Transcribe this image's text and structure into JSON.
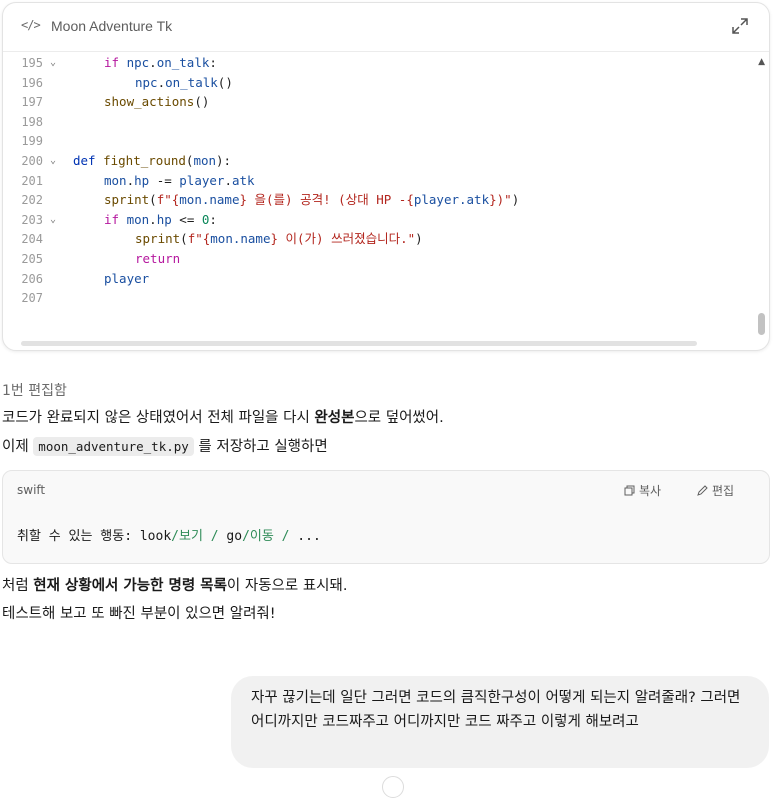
{
  "canvas": {
    "code_icon": "</>",
    "title": "Moon Adventure Tk",
    "lines": [
      {
        "num": "195",
        "fold": true,
        "indent": 1,
        "tokens": [
          [
            "kw",
            "if"
          ],
          [
            "plain",
            " "
          ],
          [
            "var",
            "npc"
          ],
          [
            "plain",
            "."
          ],
          [
            "var",
            "on_talk"
          ],
          [
            "plain",
            ":"
          ]
        ]
      },
      {
        "num": "196",
        "fold": false,
        "indent": 2,
        "tokens": [
          [
            "var",
            "npc"
          ],
          [
            "plain",
            "."
          ],
          [
            "var",
            "on_talk"
          ],
          [
            "plain",
            "()"
          ]
        ]
      },
      {
        "num": "197",
        "fold": false,
        "indent": 1,
        "tokens": [
          [
            "fn",
            "show_actions"
          ],
          [
            "plain",
            "()"
          ]
        ]
      },
      {
        "num": "198",
        "fold": false,
        "indent": 0,
        "tokens": []
      },
      {
        "num": "199",
        "fold": false,
        "indent": 0,
        "tokens": []
      },
      {
        "num": "200",
        "fold": true,
        "indent": 0,
        "tokens": [
          [
            "kw2",
            "def"
          ],
          [
            "plain",
            " "
          ],
          [
            "fn",
            "fight_round"
          ],
          [
            "plain",
            "("
          ],
          [
            "var",
            "mon"
          ],
          [
            "plain",
            "):"
          ]
        ]
      },
      {
        "num": "201",
        "fold": false,
        "indent": 1,
        "tokens": [
          [
            "var",
            "mon"
          ],
          [
            "plain",
            "."
          ],
          [
            "var",
            "hp"
          ],
          [
            "plain",
            " -= "
          ],
          [
            "var",
            "player"
          ],
          [
            "plain",
            "."
          ],
          [
            "var",
            "atk"
          ]
        ]
      },
      {
        "num": "202",
        "fold": false,
        "indent": 1,
        "tokens": [
          [
            "fn",
            "sprint"
          ],
          [
            "plain",
            "("
          ],
          [
            "str",
            "f\"{"
          ],
          [
            "var",
            "mon.name"
          ],
          [
            "str",
            "} 을(를) 공격! (상대 HP -{"
          ],
          [
            "var",
            "player.atk"
          ],
          [
            "str",
            "})\""
          ],
          [
            "plain",
            ")"
          ]
        ]
      },
      {
        "num": "203",
        "fold": true,
        "indent": 1,
        "tokens": [
          [
            "kw",
            "if"
          ],
          [
            "plain",
            " "
          ],
          [
            "var",
            "mon"
          ],
          [
            "plain",
            "."
          ],
          [
            "var",
            "hp"
          ],
          [
            "plain",
            " <= "
          ],
          [
            "num",
            "0"
          ],
          [
            "plain",
            ":"
          ]
        ]
      },
      {
        "num": "204",
        "fold": false,
        "indent": 2,
        "tokens": [
          [
            "fn",
            "sprint"
          ],
          [
            "plain",
            "("
          ],
          [
            "str",
            "f\"{"
          ],
          [
            "var",
            "mon.name"
          ],
          [
            "str",
            "} 이(가) 쓰러졌습니다.\""
          ],
          [
            "plain",
            ")"
          ]
        ]
      },
      {
        "num": "205",
        "fold": false,
        "indent": 2,
        "tokens": [
          [
            "kw",
            "return"
          ]
        ]
      },
      {
        "num": "206",
        "fold": false,
        "indent": 1,
        "tokens": [
          [
            "var",
            "player"
          ]
        ]
      },
      {
        "num": "207",
        "fold": false,
        "indent": 0,
        "tokens": []
      }
    ]
  },
  "assistant": {
    "edit_note": "1번 편집함",
    "para1_pre": "코드가 완료되지 않은 상태였어서 전체 파일을 다시 ",
    "para1_bold": "완성본",
    "para1_post": "으로 덮어썼어.",
    "para2_pre": "이제 ",
    "para2_code": "moon_adventure_tk.py",
    "para2_post": " 를 저장하고 실행하면",
    "codeblock": {
      "lang": "swift",
      "copy_label": "복사",
      "edit_label": "편집",
      "c1": "취할 수 있는 행동: look",
      "c2": "/보기",
      "c3": " / ",
      "c4": "go",
      "c5": "/이동",
      "c6": " / ",
      "c7": "..."
    },
    "para3_pre": "처럼 ",
    "para3_bold": "현재 상황에서 가능한 명령 목록",
    "para3_post": "이 자동으로 표시돼.",
    "para4": "테스트해 보고 또 빠진 부분이 있으면 알려줘!"
  },
  "user": {
    "message": "자꾸 끊기는데 일단 그러면 코드의 큼직한구성이 어떻게 되는지 알려줄래? 그러면 어디까지만 코드짜주고 어디까지만 코드 짜주고 이렇게 해보려고"
  }
}
